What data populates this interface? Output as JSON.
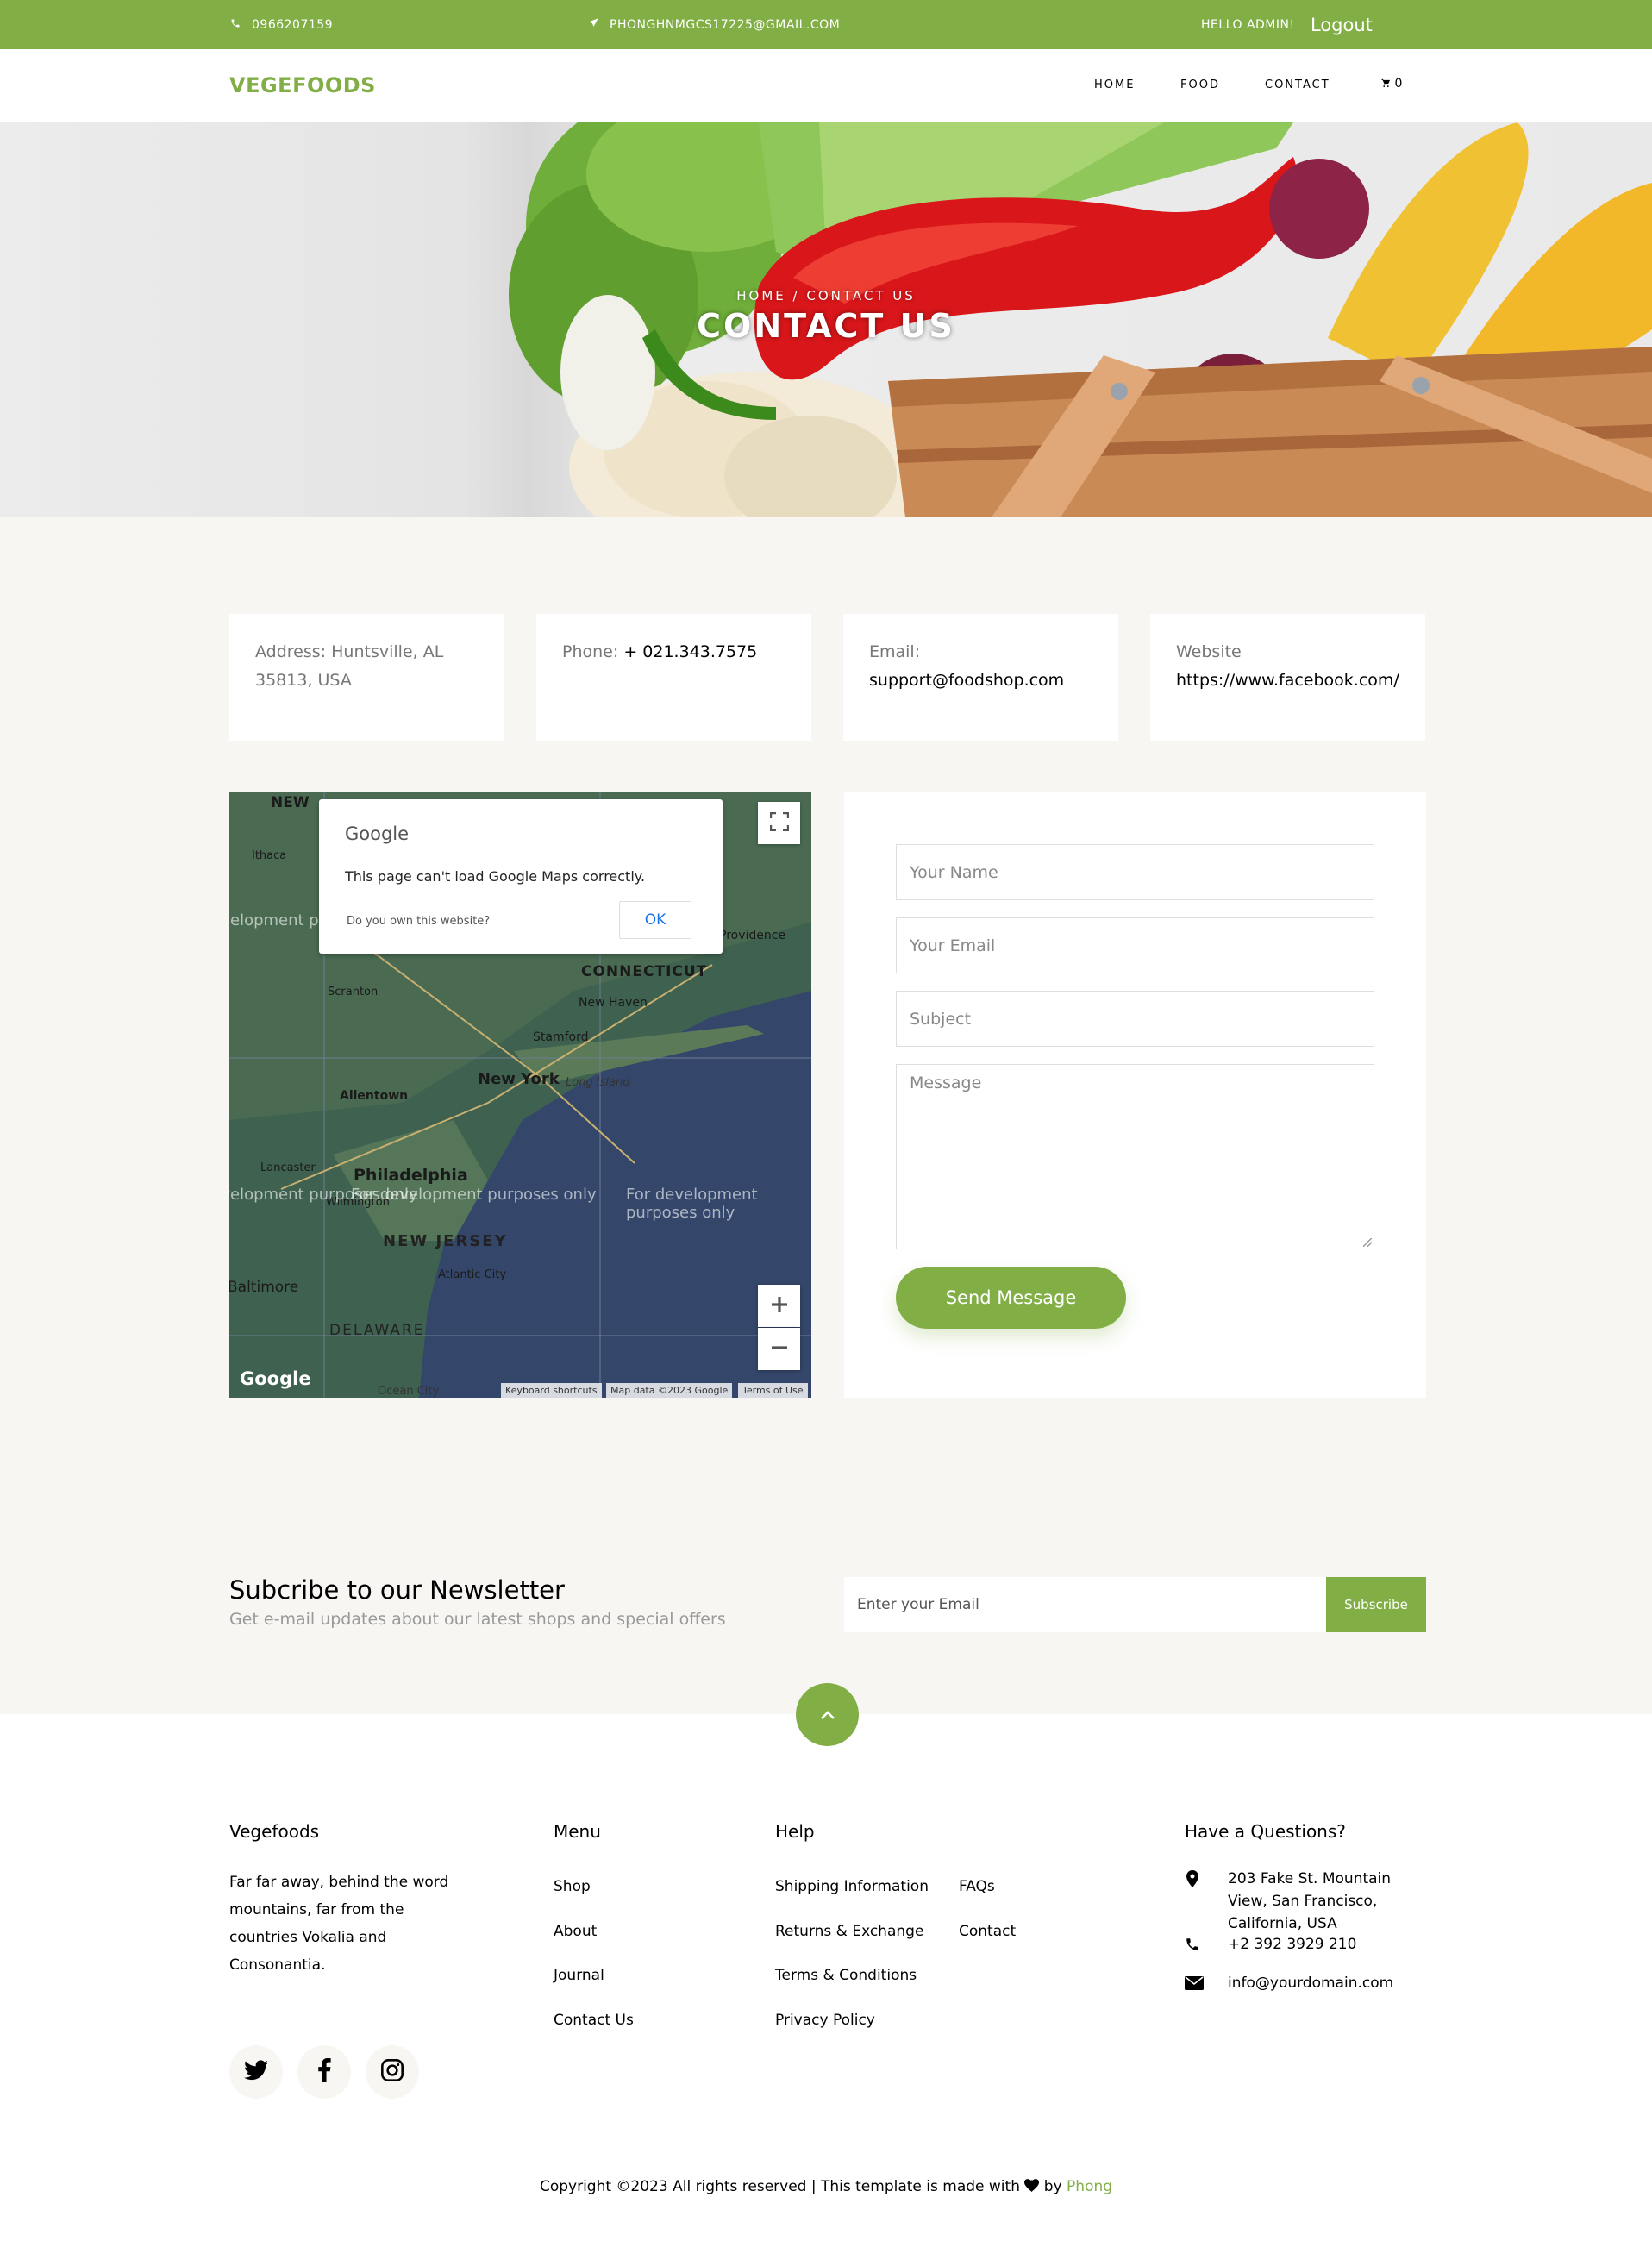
{
  "topbar": {
    "phone": "0966207159",
    "email": "PHONGHNMGCS17225@GMAIL.COM",
    "greeting": "HELLO ADMIN!",
    "logout": "Logout"
  },
  "nav": {
    "brand": "VEGEFOODS",
    "links": [
      "HOME",
      "FOOD",
      "CONTACT"
    ],
    "cart_count": "0"
  },
  "hero": {
    "breadcrumb": "HOME / CONTACT US",
    "title": "CONTACT US"
  },
  "info": {
    "address_label": "Address:",
    "address_value": "Huntsville, AL 35813, USA",
    "phone_label": "Phone:",
    "phone_value": "+ 021.343.7575",
    "email_label": "Email:",
    "email_value": "support@foodshop.com",
    "website_label": "Website",
    "website_value": "https://www.facebook.com/"
  },
  "map": {
    "dialog_brand": "Google",
    "dialog_message": "This page can't load Google Maps correctly.",
    "dialog_own": "Do you own this website?",
    "dialog_ok": "OK",
    "dev_text": "For development purposes only",
    "labels": {
      "new_york": "New York",
      "philadelphia": "Philadelphia",
      "new_jersey": "NEW JERSEY",
      "connecticut": "CONNECTICUT",
      "delaware": "DELAWARE",
      "allentown": "Allentown",
      "scranton": "Scranton",
      "new_haven": "New Haven",
      "stamford": "Stamford",
      "lancaster": "Lancaster",
      "wilmington": "Wilmington",
      "atlantic_city": "Atlantic City",
      "long_island": "Long Island",
      "providence": "Providence",
      "ithaca": "Ithaca",
      "baltimore": "Baltimore",
      "ocean_city": "Ocean City"
    },
    "logo": "Google",
    "footer_shortcuts": "Keyboard shortcuts",
    "footer_data": "Map data ©2023 Google",
    "footer_terms": "Terms of Use"
  },
  "form": {
    "name_placeholder": "Your Name",
    "email_placeholder": "Your Email",
    "subject_placeholder": "Subject",
    "message_placeholder": "Message",
    "send_label": "Send Message"
  },
  "newsletter": {
    "title": "Subcribe to our Newsletter",
    "subtitle": "Get e-mail updates about our latest shops and special offers",
    "input_placeholder": "Enter your Email",
    "button": "Subscribe"
  },
  "footer": {
    "about_title": "Vegefoods",
    "about_text": "Far far away, behind the word mountains, far from the countries Vokalia and Consonantia.",
    "menu_title": "Menu",
    "menu_items": [
      "Shop",
      "About",
      "Journal",
      "Contact Us"
    ],
    "help_title": "Help",
    "help_col1": [
      "Shipping Information",
      "Returns & Exchange",
      "Terms & Conditions",
      "Privacy Policy"
    ],
    "help_col2": [
      "FAQs",
      "Contact"
    ],
    "questions_title": "Have a Questions?",
    "address": "203 Fake St. Mountain View, San Francisco, California, USA",
    "phone": "+2 392 3929 210",
    "email": "info@yourdomain.com",
    "copyright_pre": "Copyright ©2023 All rights reserved | This template is made with",
    "copyright_by": "by",
    "copyright_author": "Phong"
  },
  "colors": {
    "accent": "#82ae46",
    "background": "#f7f6f2"
  }
}
